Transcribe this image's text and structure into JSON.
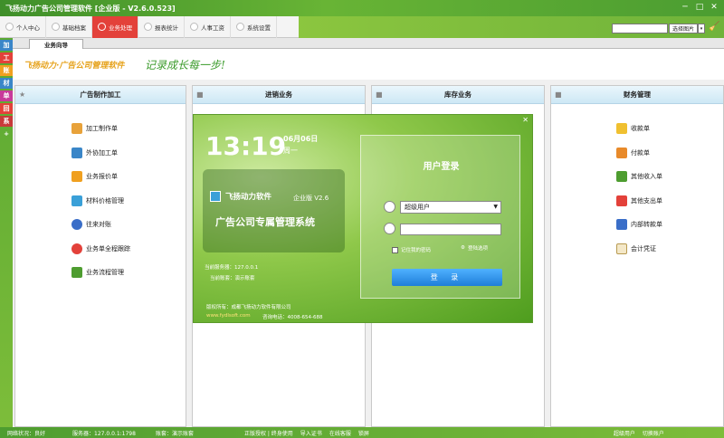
{
  "window": {
    "title": "飞扬动力广告公司管理软件 [企业版 - V2.6.0.523]"
  },
  "menu": [
    {
      "label": "个人中心"
    },
    {
      "label": "基础档案"
    },
    {
      "label": "业务处理",
      "active": true
    },
    {
      "label": "报表统计"
    },
    {
      "label": "人事工资"
    },
    {
      "label": "系统设置"
    }
  ],
  "toolbar": {
    "bg_button": "选择图片",
    "bg_dropdown": "▾"
  },
  "sidebar": [
    "加",
    "工",
    "账",
    "材",
    "单",
    "回",
    "系",
    "+"
  ],
  "tabs": [
    {
      "label": "业务向导"
    }
  ],
  "brand": {
    "name": "飞扬动力·广告公司管理软件",
    "slogan": "记录成长每一步!"
  },
  "columns": [
    {
      "title": "广告制作加工",
      "items": [
        "加工制作单",
        "外协加工单",
        "业务报价单",
        "材料价格管理",
        "往来对账",
        "业务单全程跟踪",
        "业务流程管理"
      ]
    },
    {
      "title": "进销业务",
      "items": []
    },
    {
      "title": "库存业务",
      "items": []
    },
    {
      "title": "财务管理",
      "items": [
        "收款单",
        "付款单",
        "其他收入单",
        "其他支出单",
        "内部转款单",
        "会计凭证"
      ]
    }
  ],
  "login": {
    "time": "13:19",
    "date": "06月06日",
    "weekday": "周一",
    "product_name": "飞扬动力软件",
    "edition": "企业版  V2.6",
    "product_subtitle": "广告公司专属管理系统",
    "server_label": "当前服务器：127.0.0.1",
    "account_label": "当前账套：演示账套",
    "owner": "版权所有：成都飞扬动力软件有限公司",
    "website": "www.fydlsoft.com",
    "phone": "咨询电话：4008-654-688",
    "panel_title": "用户登录",
    "user_value": "超级用户",
    "remember_label": "记住我的密码",
    "settings_label": "登陆选项",
    "login_button": "登 录"
  },
  "status": {
    "network": "网络状况：良好",
    "server": "服务器：127.0.0.1:1798",
    "account": "账套：演示账套",
    "mode": "正版授权 | 终身使用",
    "import": "导入证书",
    "support": "在线客服",
    "lock": "锁屏",
    "user": "超级用户",
    "switch": "切换账户"
  },
  "colors": {
    "accent": "#6fb33a",
    "active_tab": "#e3413a",
    "login_btn": "#1f7ed8"
  }
}
